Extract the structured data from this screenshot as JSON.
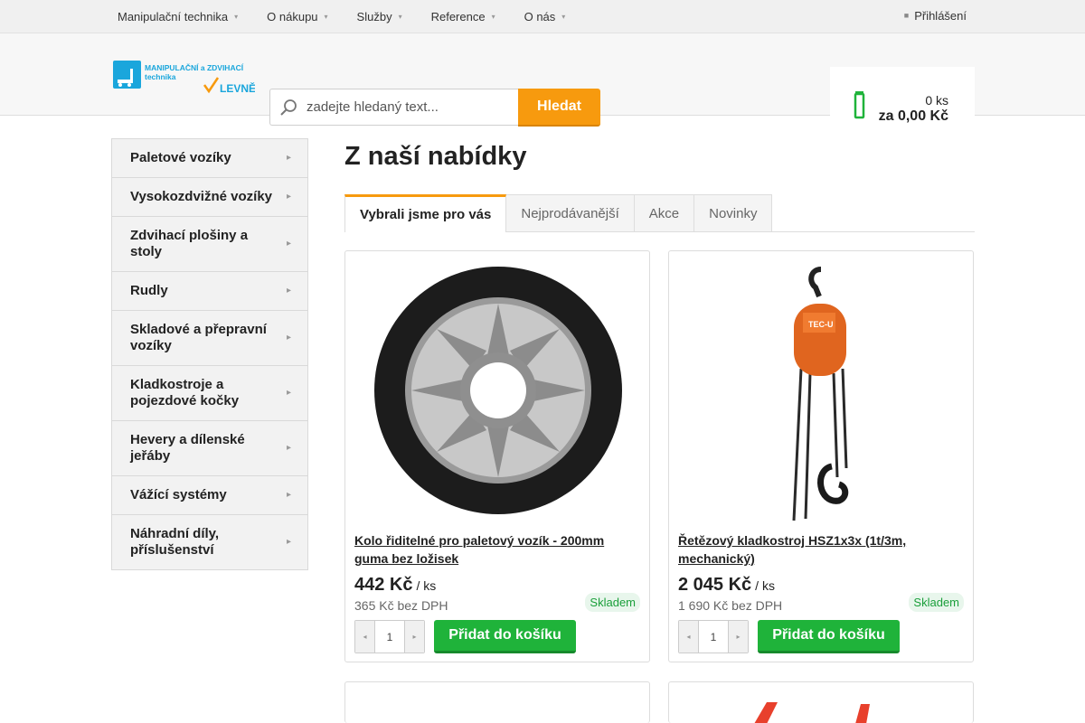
{
  "topnav": {
    "items": [
      {
        "label": "Manipulační technika"
      },
      {
        "label": "O nákupu"
      },
      {
        "label": "Služby"
      },
      {
        "label": "Reference"
      },
      {
        "label": "O nás"
      }
    ],
    "login_label": "Přihlášení"
  },
  "header": {
    "logo_text_line1": "MANIPULAČNÍ a ZDVIHACÍ",
    "logo_text_line2": "technika",
    "logo_text_levne": "LEVNĚ",
    "search_placeholder": "zadejte hledaný text...",
    "search_button_label": "Hledat",
    "cart_count": "0 ks",
    "cart_total": "za 0,00 Kč"
  },
  "sidebar": {
    "items": [
      {
        "label": "Paletové vozíky"
      },
      {
        "label": "Vysokozdvižné vozíky"
      },
      {
        "label": "Zdvihací plošiny a stoly"
      },
      {
        "label": "Rudly"
      },
      {
        "label": "Skladové a přepravní vozíky"
      },
      {
        "label": "Kladkostroje a pojezdové kočky"
      },
      {
        "label": "Hevery a dílenské jeřáby"
      },
      {
        "label": "Vážící systémy"
      },
      {
        "label": "Náhradní díly, příslušenství"
      }
    ]
  },
  "main": {
    "title": "Z naší nabídky",
    "tabs": [
      {
        "label": "Vybrali jsme pro vás",
        "active": true
      },
      {
        "label": "Nejprodávanější",
        "active": false
      },
      {
        "label": "Akce",
        "active": false
      },
      {
        "label": "Novinky",
        "active": false
      }
    ],
    "products": [
      {
        "name": "Kolo řiditelné pro paletový vozík - 200mm guma bez ložisek",
        "price": "442 Kč",
        "unit": "/ ks",
        "price_ex_vat": "365 Kč bez DPH",
        "stock": "Skladem",
        "qty": "1",
        "add_label": "Přidat do košíku"
      },
      {
        "name": "Řetězový kladkostroj HSZ1x3x (1t/3m, mechanický)",
        "price": "2 045 Kč",
        "unit": "/ ks",
        "price_ex_vat": "1 690 Kč bez DPH",
        "stock": "Skladem",
        "qty": "1",
        "add_label": "Přidat do košíku"
      }
    ],
    "hoist_label": "TEC-U"
  },
  "colors": {
    "accent_orange": "#f79a0e",
    "accent_green": "#1fb33a",
    "logo_blue": "#1aa6dc"
  }
}
